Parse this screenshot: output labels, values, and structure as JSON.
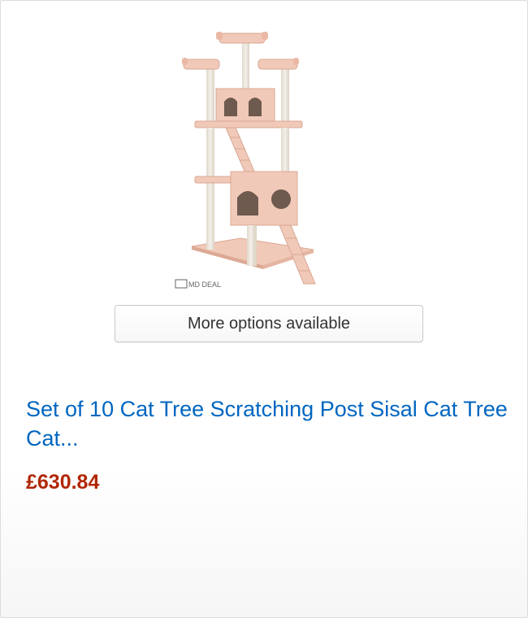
{
  "product": {
    "watermark": "MD DEAL",
    "options_label": "More options available",
    "title": "Set of 10 Cat Tree Scratching Post Sisal Cat Tree Cat...",
    "price": "£630.84"
  },
  "colors": {
    "link": "#0066c0",
    "price": "#b12704",
    "plush": "#f1c9b8",
    "sisal": "#eee9e0"
  }
}
